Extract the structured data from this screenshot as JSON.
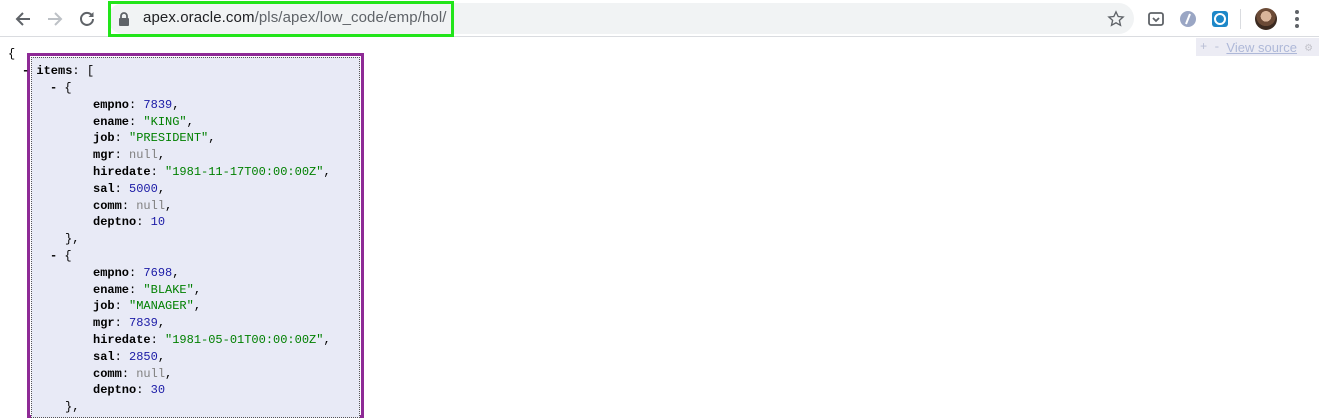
{
  "browser": {
    "url_host": "apex.oracle.com",
    "url_path": "/pls/apex/low_code/emp/hol/"
  },
  "json_viewer": {
    "expand_label": "+",
    "collapse_label": "-",
    "view_source_label": "View source",
    "root_open": "{",
    "items_key": "items",
    "items_open": "[",
    "records": [
      {
        "open": "{",
        "close": "},",
        "fields": [
          {
            "key": "empno",
            "value": "7839",
            "type": "num"
          },
          {
            "key": "ename",
            "value": "\"KING\"",
            "type": "str"
          },
          {
            "key": "job",
            "value": "\"PRESIDENT\"",
            "type": "str"
          },
          {
            "key": "mgr",
            "value": "null",
            "type": "nul"
          },
          {
            "key": "hiredate",
            "value": "\"1981-11-17T00:00:00Z\"",
            "type": "str"
          },
          {
            "key": "sal",
            "value": "5000",
            "type": "num"
          },
          {
            "key": "comm",
            "value": "null",
            "type": "nul"
          },
          {
            "key": "deptno",
            "value": "10",
            "type": "num"
          }
        ]
      },
      {
        "open": "{",
        "close": "},",
        "fields": [
          {
            "key": "empno",
            "value": "7698",
            "type": "num"
          },
          {
            "key": "ename",
            "value": "\"BLAKE\"",
            "type": "str"
          },
          {
            "key": "job",
            "value": "\"MANAGER\"",
            "type": "str"
          },
          {
            "key": "mgr",
            "value": "7839",
            "type": "num"
          },
          {
            "key": "hiredate",
            "value": "\"1981-05-01T00:00:00Z\"",
            "type": "str"
          },
          {
            "key": "sal",
            "value": "2850",
            "type": "num"
          },
          {
            "key": "comm",
            "value": "null",
            "type": "nul"
          },
          {
            "key": "deptno",
            "value": "30",
            "type": "num"
          }
        ]
      }
    ]
  },
  "colors": {
    "url_highlight": "#22e51a",
    "items_highlight": "#8e2a96",
    "number": "#1a1aa6",
    "string": "#008000",
    "null": "#808080"
  }
}
